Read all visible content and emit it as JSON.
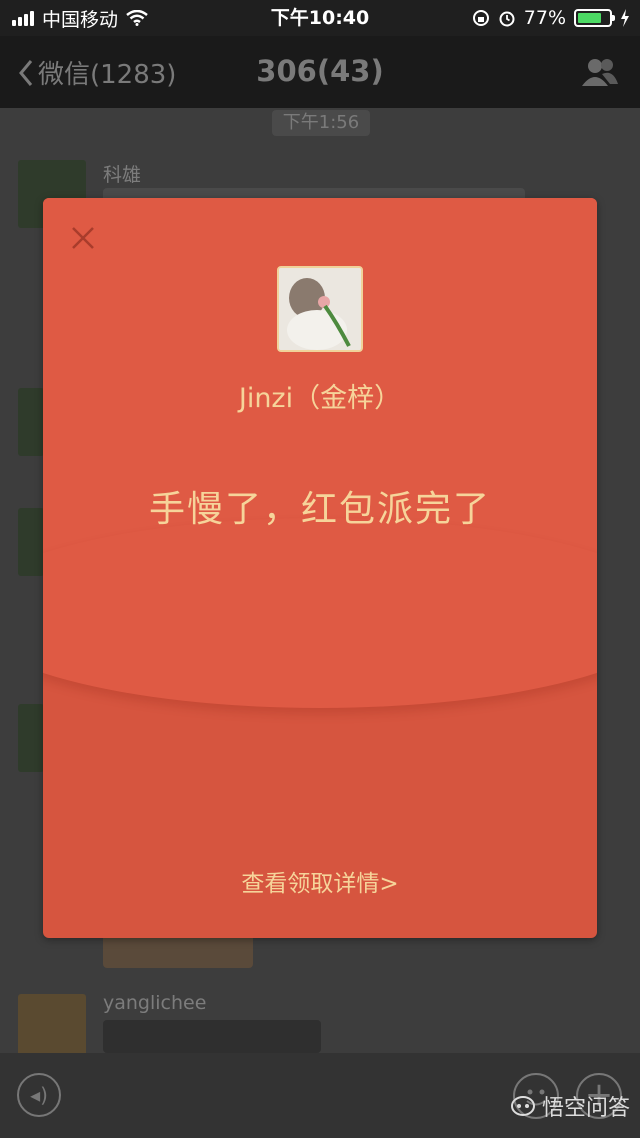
{
  "status_bar": {
    "carrier": "中国移动",
    "time": "下午10:40",
    "battery_percent": "77%",
    "battery_level": 0.77
  },
  "nav": {
    "back_label": "微信(1283)",
    "title": "306(43)"
  },
  "chat": {
    "timestamp": "下午1:56",
    "senders": [
      "科雄",
      "yanglichee"
    ]
  },
  "red_packet": {
    "sender_name": "Jinzi（金梓）",
    "message": "手慢了，红包派完了",
    "details_link": "查看领取详情>"
  },
  "watermark": "悟空问答",
  "icons": [
    "signal-icon",
    "wifi-icon",
    "lock-rotation-icon",
    "alarm-icon",
    "battery-icon",
    "charging-icon",
    "back-chevron-icon",
    "group-members-icon",
    "close-icon",
    "voice-icon",
    "emoji-icon",
    "plus-icon",
    "wukong-logo-icon"
  ],
  "colors": {
    "packet": "#d6553f",
    "packet_text": "#f6d49a",
    "overlay": "#3d3d3d"
  }
}
